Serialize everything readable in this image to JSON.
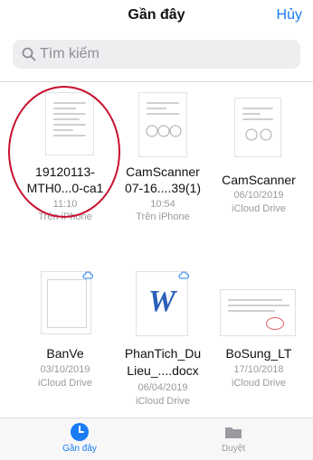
{
  "header": {
    "title": "Gần đây",
    "cancel_label": "Hủy"
  },
  "search": {
    "placeholder": "Tìm kiếm",
    "icon": "search-icon"
  },
  "files": [
    {
      "name_line1": "19120113-",
      "name_line2": "MTH0...0-ca1",
      "meta1": "11:10",
      "meta2": "Trên iPhone",
      "highlighted": true
    },
    {
      "name_line1": "CamScanner",
      "name_line2": "07-16....39(1)",
      "meta1": "10:54",
      "meta2": "Trên iPhone"
    },
    {
      "name_line1": "CamScanner",
      "name_line2": "",
      "meta1": "06/10/2019",
      "meta2": "iCloud Drive"
    },
    {
      "name_line1": "BanVe",
      "name_line2": "",
      "meta1": "03/10/2019",
      "meta2": "iCloud Drive"
    },
    {
      "name_line1": "PhanTich_Du",
      "name_line2": "Lieu_....docx",
      "meta1": "06/04/2019",
      "meta2": "iCloud Drive"
    },
    {
      "name_line1": "BoSung_LT",
      "name_line2": "",
      "meta1": "17/10/2018",
      "meta2": "iCloud Drive"
    }
  ],
  "word_glyph": "W",
  "tabbar": {
    "recent_label": "Gần đây",
    "browse_label": "Duyệt"
  },
  "colors": {
    "accent": "#1a7cf5",
    "highlight_circle": "#c8102e",
    "word_blue": "#2b5fb8"
  }
}
